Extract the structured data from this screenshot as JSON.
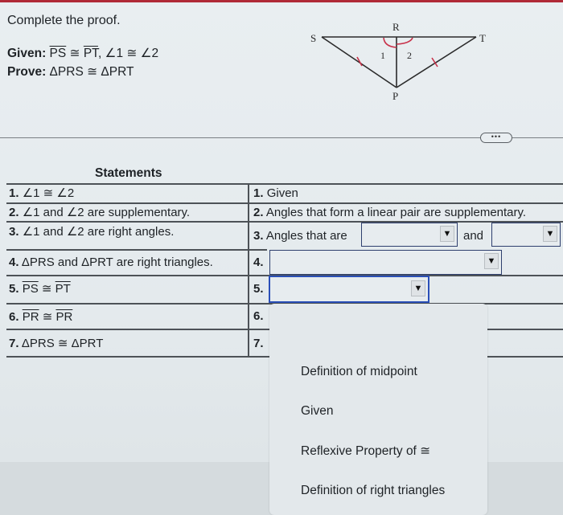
{
  "header": {
    "title": "Complete the proof.",
    "given_label": "Given:",
    "given_seg1": "PS",
    "given_cong1": " ≅ ",
    "given_seg2": "PT",
    "given_rest": ", ∠1 ≅ ∠2",
    "prove_label": "Prove:",
    "prove_text": " ΔPRS ≅ ΔPRT"
  },
  "diagram": {
    "points": {
      "S": "S",
      "R": "R",
      "T": "T",
      "P": "P"
    },
    "angle_labels": {
      "a1": "1",
      "a2": "2"
    },
    "mark_color": "#c8324a"
  },
  "more_button": {
    "label": "•••"
  },
  "table": {
    "statements_header": "Statements",
    "rows": [
      {
        "num": "1.",
        "statement": "∠1 ≅ ∠2",
        "reason_num": "1.",
        "reason": "Given"
      },
      {
        "num": "2.",
        "statement": "∠1 and ∠2 are supplementary.",
        "reason_num": "2.",
        "reason": "Angles that form a linear pair are supplementary."
      },
      {
        "num": "3.",
        "statement": "∠1 and ∠2 are right angles.",
        "reason_num": "3.",
        "reason": "Angles that are",
        "reason_and": "and",
        "select1_value": "",
        "select2_value": ""
      },
      {
        "num": "4.",
        "statement": "ΔPRS and ΔPRT are right triangles.",
        "reason_num": "4.",
        "select_value": ""
      },
      {
        "num": "5.",
        "statement_seg1": "PS",
        "statement_cong": " ≅ ",
        "statement_seg2": "PT",
        "reason_num": "5.",
        "select_value": ""
      },
      {
        "num": "6.",
        "statement_seg1": "PR",
        "statement_cong": " ≅ ",
        "statement_seg2": "PR",
        "reason_num": "6."
      },
      {
        "num": "7.",
        "statement": "ΔPRS ≅ ΔPRT",
        "reason_num": "7."
      }
    ]
  },
  "dropdown": {
    "options": [
      "Definition of midpoint",
      "Given",
      "Reflexive Property of  ≅",
      "Definition of right triangles"
    ]
  },
  "select_arrow": "▼"
}
